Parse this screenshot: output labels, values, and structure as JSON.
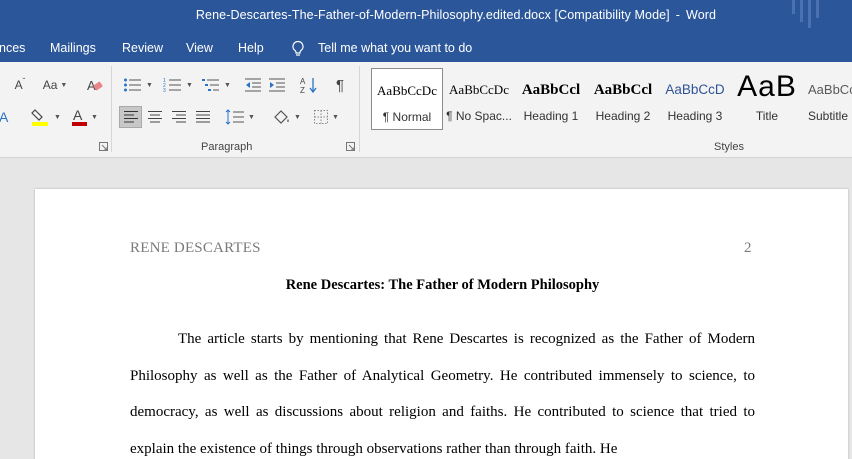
{
  "window": {
    "filename": "Rene-Descartes-The-Father-of-Modern-Philosophy.edited.docx",
    "mode": "[Compatibility Mode]",
    "separator": "-",
    "app": "Word"
  },
  "menu": {
    "tabs": [
      {
        "id": "references",
        "label": "nces"
      },
      {
        "id": "mailings",
        "label": "Mailings"
      },
      {
        "id": "review",
        "label": "Review"
      },
      {
        "id": "view",
        "label": "View"
      },
      {
        "id": "help",
        "label": "Help"
      }
    ],
    "tell_me": "Tell me what you want to do"
  },
  "ribbon": {
    "font_group": {
      "case_label": "Aa",
      "shrink_label": "A"
    },
    "paragraph_group": {
      "label": "Paragraph",
      "sort_label": "A↓",
      "pilcrow": "¶"
    },
    "styles_group": {
      "label": "Styles",
      "items": [
        {
          "preview": "AaBbCcDc",
          "name": "¶ Normal"
        },
        {
          "preview": "AaBbCcDc",
          "name": "¶ No Spac..."
        },
        {
          "preview": "AaBbCcl",
          "name": "Heading 1"
        },
        {
          "preview": "AaBbCcl",
          "name": "Heading 2"
        },
        {
          "preview": "AaBbCcD",
          "name": "Heading 3"
        },
        {
          "preview": "AaB",
          "name": "Title"
        },
        {
          "preview": "AaBbCc",
          "name": "Subtitle"
        }
      ]
    }
  },
  "colors": {
    "brand": "#2b579a",
    "highlight": "#ffff00",
    "font_color": "#c00000",
    "heading_blue": "#2f5496"
  },
  "document": {
    "header_left": "RENE DESCARTES",
    "page_number": "2",
    "title": "Rene Descartes: The Father of Modern Philosophy",
    "body": "The article starts by mentioning that Rene Descartes is recognized as the Father of Modern Philosophy as well as the Father of Analytical Geometry. He contributed immensely to science, to democracy, as well as discussions about religion and faiths. He contributed to science that tried to explain the existence of things through observations rather than through faith. He"
  }
}
